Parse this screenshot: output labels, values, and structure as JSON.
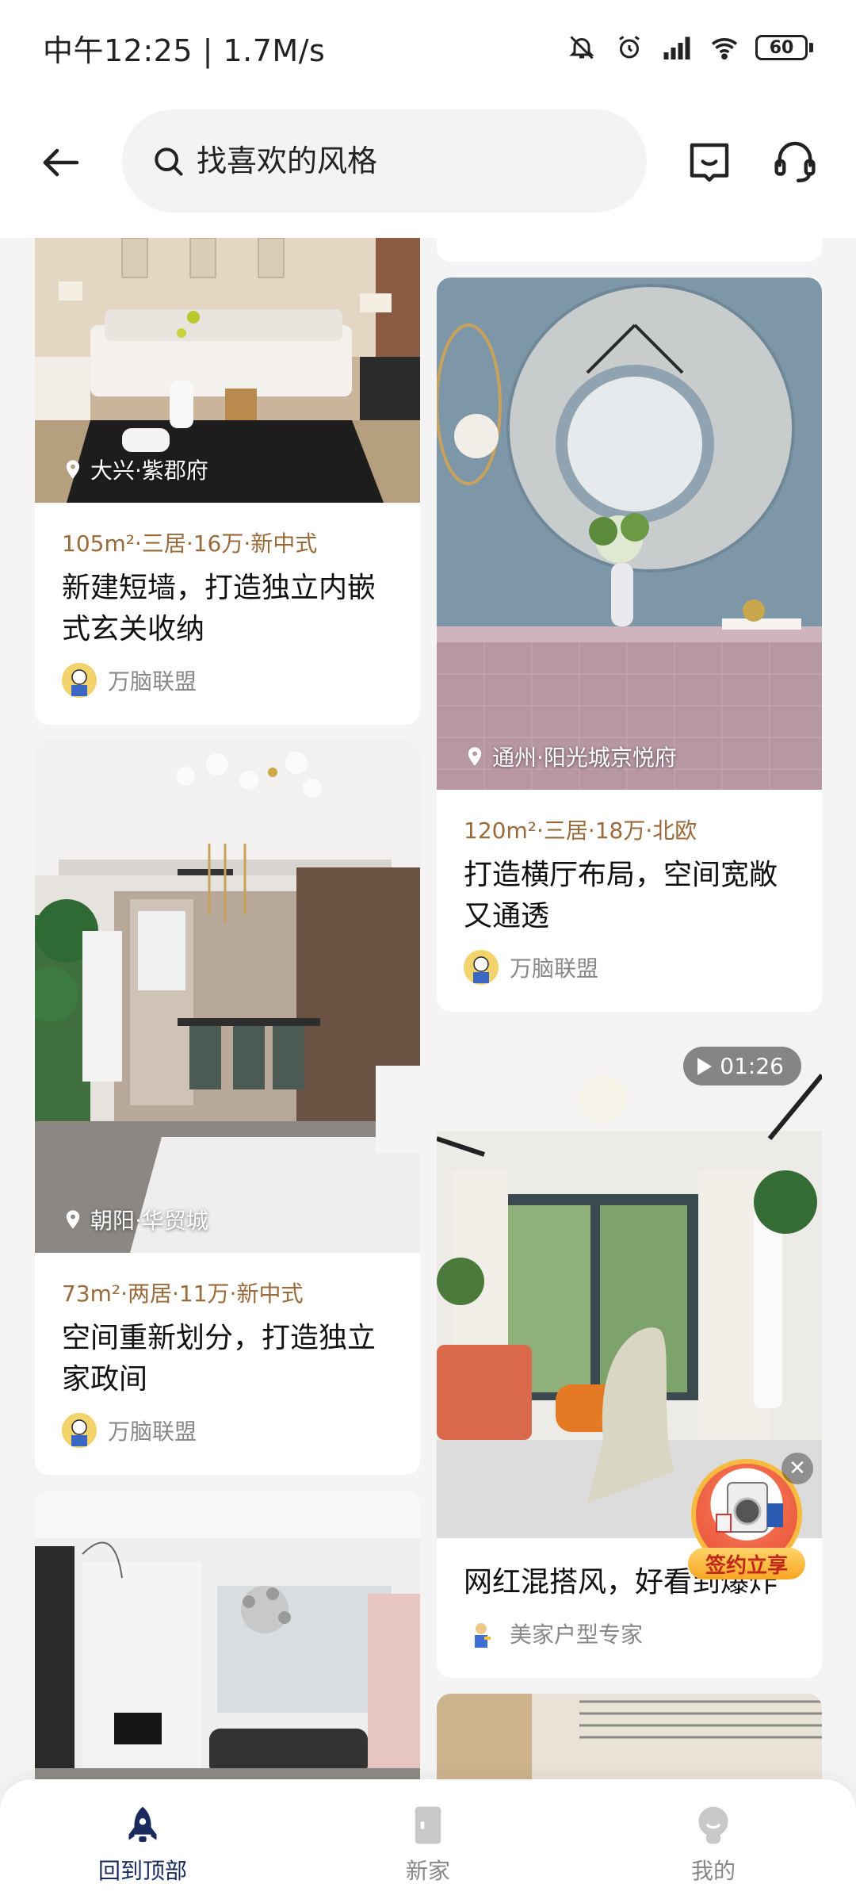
{
  "status_bar": {
    "time": "中午12:25",
    "speed": "1.7M/s",
    "battery": "60"
  },
  "header": {
    "search_placeholder": "找喜欢的风格"
  },
  "cards_left": [
    {
      "location": "大兴·紫郡府",
      "meta": "105m²·三居·16万·新中式",
      "title": "新建短墙，打造独立内嵌式玄关收纳",
      "author": "万脑联盟"
    },
    {
      "location": "朝阳·华贸城",
      "meta": "73m²·两居·11万·新中式",
      "title": "空间重新划分，打造独立家政间",
      "author": "万脑联盟"
    }
  ],
  "cards_right": [
    {
      "location": "通州·阳光城京悦府",
      "meta": "120m²·三居·18万·北欧",
      "title": "打造横厅布局，空间宽敞又通透",
      "author": "万脑联盟"
    },
    {
      "duration": "01:26",
      "title": "网红混搭风，好看到爆炸",
      "author": "美家户型专家"
    }
  ],
  "promo": {
    "label": "签约立享",
    "close_icon": "close-icon"
  },
  "bottom_nav": {
    "items": [
      {
        "label": "回到顶部",
        "icon": "rocket-icon",
        "active": true
      },
      {
        "label": "新家",
        "icon": "door-icon",
        "active": false
      },
      {
        "label": "我的",
        "icon": "profile-icon",
        "active": false
      }
    ]
  },
  "colors": {
    "accent_meta": "#9a6a3a",
    "nav_active": "#1a2a5e",
    "background": "#f4f4f4"
  }
}
